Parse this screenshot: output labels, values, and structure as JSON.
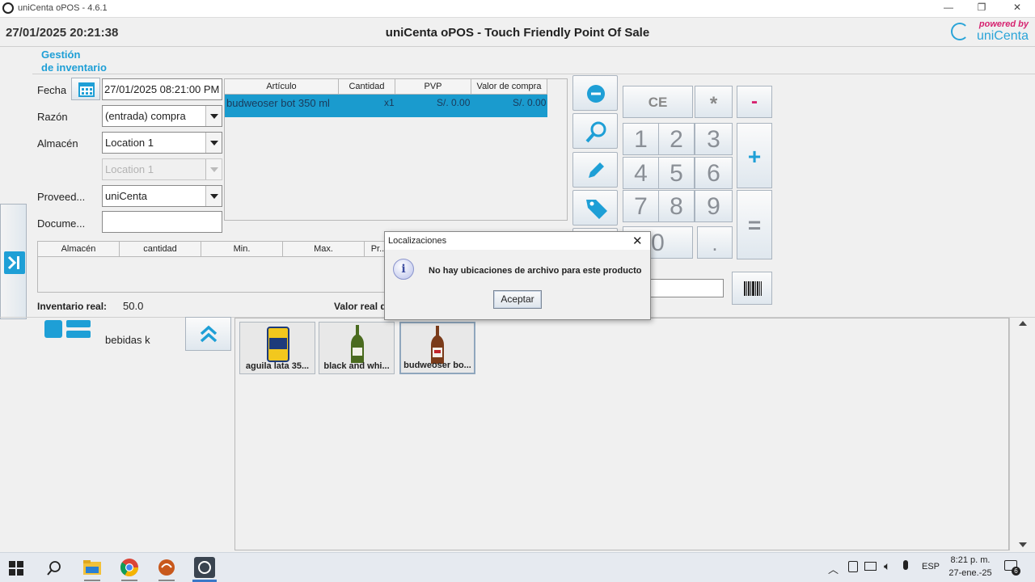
{
  "window": {
    "title": "uniCenta oPOS - 4.6.1",
    "controls": [
      "—",
      "❐",
      "✕"
    ]
  },
  "header": {
    "datetime": "27/01/2025 20:21:38",
    "title": "uniCenta oPOS - Touch Friendly Point Of Sale",
    "logo_powered": "powered by",
    "logo_name": "uniCenta"
  },
  "section": {
    "title_line1": "Gestión",
    "title_line2": "de inventario"
  },
  "form": {
    "fecha_label": "Fecha",
    "fecha_value": "27/01/2025 08:21:00 PM",
    "razon_label": "Razón",
    "razon_value": "(entrada) compra",
    "almacen_label": "Almacén",
    "almacen_value": "Location 1",
    "almacen2_value": "Location 1",
    "proveedor_label": "Proveed...",
    "proveedor_value": "uniCenta",
    "documento_label": "Docume...",
    "documento_value": ""
  },
  "lines_table": {
    "headers": [
      "Artículo",
      "Cantidad",
      "PVP",
      "Valor de compra"
    ],
    "rows": [
      {
        "articulo": "budweoser bot 350 ml",
        "cantidad": "x1",
        "pvp": "S/. 0.00",
        "valor": "S/. 0.00"
      }
    ]
  },
  "stock_table": {
    "headers": [
      "Almacén",
      "cantidad",
      "Min.",
      "Max.",
      "Pr..."
    ]
  },
  "inventory": {
    "real_label": "Inventario real:",
    "real_value": "50.0",
    "valor_label": "Valor real de..."
  },
  "category": {
    "name": "bebidas k"
  },
  "keypad": {
    "ce": "CE",
    "mult": "*",
    "minus": "-",
    "plus": "+",
    "equals": "=",
    "dot": ".",
    "digits": [
      "1",
      "2",
      "3",
      "4",
      "5",
      "6",
      "7",
      "8",
      "9",
      "0"
    ]
  },
  "products": [
    {
      "caption": "aguila lata 35..."
    },
    {
      "caption": "black and whi..."
    },
    {
      "caption": "budweoser bo..."
    }
  ],
  "dialog": {
    "title": "Localizaciones",
    "message": "No hay ubicaciones de archivo para este producto",
    "button": "Aceptar",
    "close": "✕"
  },
  "taskbar": {
    "lang": "ESP",
    "time": "8:21 p. m.",
    "date": "27-ene.-25",
    "notif_count": "6"
  },
  "colors": {
    "accent": "#1e9fd6",
    "selection": "#1a9bce",
    "brand_pink": "#d6226f"
  }
}
